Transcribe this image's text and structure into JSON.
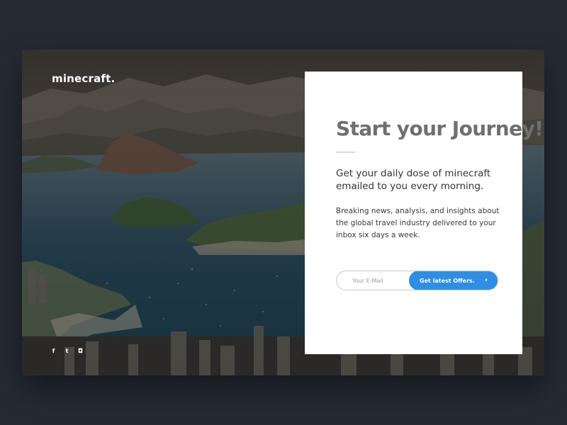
{
  "brand": {
    "logo_text": "minecraft."
  },
  "social": [
    {
      "icon": "facebook-icon",
      "glyph": "f"
    },
    {
      "icon": "twitter-icon",
      "glyph": "t"
    },
    {
      "icon": "instagram-icon",
      "glyph": "◘"
    }
  ],
  "signup": {
    "title": "Start your Journey!",
    "lead": "Get your daily dose of minecraft emailed to you every morning.",
    "body": "Breaking news, analysis, and insights about the global travel industry delivered to your inbox six days a week.",
    "email_placeholder": "Your E-Mail",
    "button_label": "Get latest Offers.",
    "button_arrow": "›"
  },
  "colors": {
    "page_background": "#252a35",
    "accent": "#2f8de4",
    "card": "#ffffff",
    "title": "#6f6f6f"
  }
}
